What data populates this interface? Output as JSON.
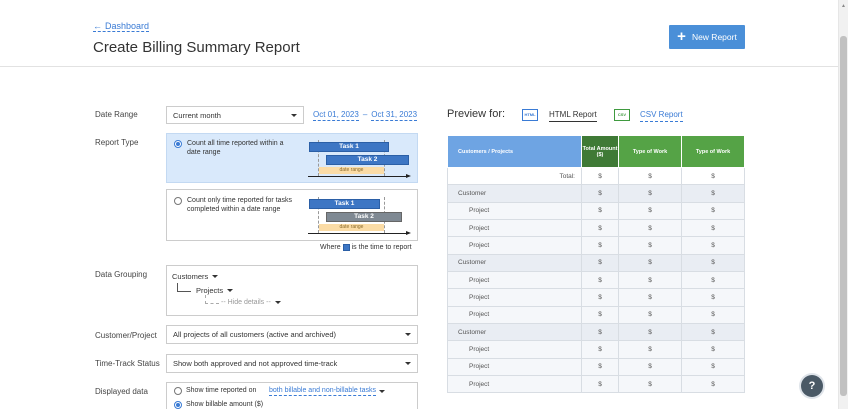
{
  "header": {
    "back_label": "Dashboard",
    "title": "Create Billing Summary Report",
    "new_report_label": "New Report"
  },
  "form": {
    "date_range": {
      "label": "Date Range",
      "selected": "Current month",
      "start": "Oct 01, 2023",
      "separator": "–",
      "end": "Oct 31, 2023"
    },
    "report_type": {
      "label": "Report Type",
      "option1": "Count all time reported within a date range",
      "option2": "Count only time reported for tasks completed within a date range",
      "task1": "Task 1",
      "task2": "Task 2",
      "date_range_tag": "date range",
      "where_prefix": "Where",
      "where_suffix": "is the time to report"
    },
    "data_grouping": {
      "label": "Data Grouping",
      "level1": "Customers",
      "level2": "Projects",
      "level3": "-- Hide details --"
    },
    "customer_project": {
      "label": "Customer/Project",
      "selected": "All projects of all customers (active and archived)"
    },
    "time_track_status": {
      "label": "Time-Track Status",
      "selected": "Show both approved and not approved time-track"
    },
    "displayed_data": {
      "label": "Displayed data",
      "option1": "Show time reported on",
      "option1_link": "both billable and non-billable tasks",
      "option2": "Show billable amount ($)"
    }
  },
  "preview": {
    "label": "Preview for:",
    "html_icon": "HTML",
    "html_tab": "HTML Report",
    "csv_icon": "CSV",
    "csv_tab": "CSV Report",
    "columns": [
      "Customers / Projects",
      "Total Amount ($)",
      "Type of Work",
      "Type of Work"
    ],
    "rows": [
      {
        "kind": "total",
        "name": "Total:",
        "values": [
          "$",
          "$",
          "$"
        ]
      },
      {
        "kind": "cust",
        "name": "Customer",
        "values": [
          "$",
          "$",
          "$"
        ]
      },
      {
        "kind": "proj",
        "name": "Project",
        "values": [
          "$",
          "$",
          "$"
        ]
      },
      {
        "kind": "proj",
        "name": "Project",
        "values": [
          "$",
          "$",
          "$"
        ]
      },
      {
        "kind": "proj",
        "name": "Project",
        "values": [
          "$",
          "$",
          "$"
        ]
      },
      {
        "kind": "cust",
        "name": "Customer",
        "values": [
          "$",
          "$",
          "$"
        ]
      },
      {
        "kind": "proj",
        "name": "Project",
        "values": [
          "$",
          "$",
          "$"
        ]
      },
      {
        "kind": "proj",
        "name": "Project",
        "values": [
          "$",
          "$",
          "$"
        ]
      },
      {
        "kind": "proj",
        "name": "Project",
        "values": [
          "$",
          "$",
          "$"
        ]
      },
      {
        "kind": "cust",
        "name": "Customer",
        "values": [
          "$",
          "$",
          "$"
        ]
      },
      {
        "kind": "proj",
        "name": "Project",
        "values": [
          "$",
          "$",
          "$"
        ]
      },
      {
        "kind": "proj",
        "name": "Project",
        "values": [
          "$",
          "$",
          "$"
        ]
      },
      {
        "kind": "proj",
        "name": "Project",
        "values": [
          "$",
          "$",
          "$"
        ]
      }
    ]
  },
  "help_label": "?",
  "colors": {
    "accent": "#4a8fd8",
    "link": "#3a7bd5",
    "header_blue": "#6ea4e3",
    "header_dark_green": "#3f7a36",
    "header_green": "#55a346"
  }
}
